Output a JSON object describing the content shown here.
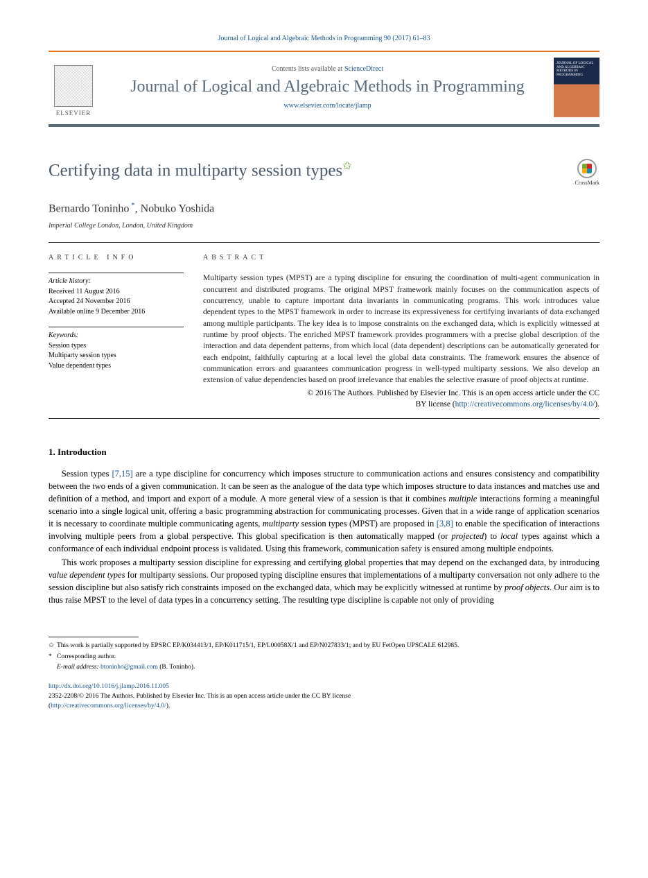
{
  "top_citation": "Journal of Logical and Algebraic Methods in Programming 90 (2017) 61–83",
  "header": {
    "contents_prefix": "Contents lists available at ",
    "contents_link": "ScienceDirect",
    "journal_name": "Journal of Logical and Algebraic Methods in Programming",
    "journal_url": "www.elsevier.com/locate/jlamp",
    "elsevier_label": "ELSEVIER",
    "cover_text": "JOURNAL OF LOGICAL AND ALGEBRAIC METHODS IN PROGRAMMING"
  },
  "title": "Certifying data in multiparty session types",
  "crossmark_label": "CrossMark",
  "authors": "Bernardo Toninho *, Nobuko Yoshida",
  "affiliation": "Imperial College London, London, United Kingdom",
  "article_info": {
    "heading": "article info",
    "history_label": "Article history:",
    "received": "Received 11 August 2016",
    "accepted": "Accepted 24 November 2016",
    "online": "Available online 9 December 2016",
    "keywords_label": "Keywords:",
    "keywords": [
      "Session types",
      "Multiparty session types",
      "Value dependent types"
    ]
  },
  "abstract": {
    "heading": "abstract",
    "text": "Multiparty session types (MPST) are a typing discipline for ensuring the coordination of multi-agent communication in concurrent and distributed programs. The original MPST framework mainly focuses on the communication aspects of concurrency, unable to capture important data invariants in communicating programs. This work introduces value dependent types to the MPST framework in order to increase its expressiveness for certifying invariants of data exchanged among multiple participants. The key idea is to impose constraints on the exchanged data, which is explicitly witnessed at runtime by proof objects. The enriched MPST framework provides programmers with a precise global description of the interaction and data dependent patterns, from which local (data dependent) descriptions can be automatically generated for each endpoint, faithfully capturing at a local level the global data constraints. The framework ensures the absence of communication errors and guarantees communication progress in well-typed multiparty sessions. We also develop an extension of value dependencies based on proof irrelevance that enables the selective erasure of proof objects at runtime.",
    "copyright_line1": "© 2016 The Authors. Published by Elsevier Inc. This is an open access article under the CC",
    "copyright_line2_prefix": "BY license (",
    "copyright_url": "http://creativecommons.org/licenses/by/4.0/",
    "copyright_line2_suffix": ")."
  },
  "section1": {
    "heading": "1. Introduction",
    "para1_a": "Session types ",
    "para1_ref1": "[7,15]",
    "para1_b": " are a type discipline for concurrency which imposes structure to communication actions and ensures consistency and compatibility between the two ends of a given communication. It can be seen as the analogue of the data type which imposes structure to data instances and matches use and definition of a method, and import and export of a module. A more general view of a session is that it combines ",
    "para1_it1": "multiple",
    "para1_c": " interactions forming a meaningful scenario into a single logical unit, offering a basic programming abstraction for communicating processes. Given that in a wide range of application scenarios it is necessary to coordinate multiple communicating agents, ",
    "para1_it2": "multiparty",
    "para1_d": " session types (MPST) are proposed in ",
    "para1_ref2": "[3,8]",
    "para1_e": " to enable the specification of interactions involving multiple peers from a global perspective. This global specification is then automatically mapped (or ",
    "para1_it3": "projected",
    "para1_f": ") to ",
    "para1_it4": "local",
    "para1_g": " types against which a conformance of each individual endpoint process is validated. Using this framework, communication safety is ensured among multiple endpoints.",
    "para2_a": "This work proposes a multiparty session discipline for expressing and certifying global properties that may depend on the exchanged data, by introducing ",
    "para2_it1": "value dependent types",
    "para2_b": " for multiparty sessions. Our proposed typing discipline ensures that implementations of a multiparty conversation not only adhere to the session discipline but also satisfy rich constraints imposed on the exchanged data, which may be explicitly witnessed at runtime by ",
    "para2_it2": "proof objects",
    "para2_c": ". Our aim is to thus raise MPST to the level of data types in a concurrency setting. The resulting type discipline is capable not only of providing"
  },
  "footnotes": {
    "fn1": "This work is partially supported by EPSRC EP/K034413/1, EP/K011715/1, EP/L00058X/1 and EP/N027833/1; and by EU FetOpen UPSCALE 612985.",
    "fn2_label": "Corresponding author.",
    "fn3_label": "E-mail address:",
    "fn3_email": "btoninho@gmail.com",
    "fn3_name": " (B. Toninho)."
  },
  "doi": {
    "url": "http://dx.doi.org/10.1016/j.jlamp.2016.11.005",
    "line1": "2352-2208/© 2016 The Authors. Published by Elsevier Inc. This is an open access article under the CC BY license",
    "line2_prefix": "(",
    "line2_url": "http://creativecommons.org/licenses/by/4.0/",
    "line2_suffix": ")."
  }
}
